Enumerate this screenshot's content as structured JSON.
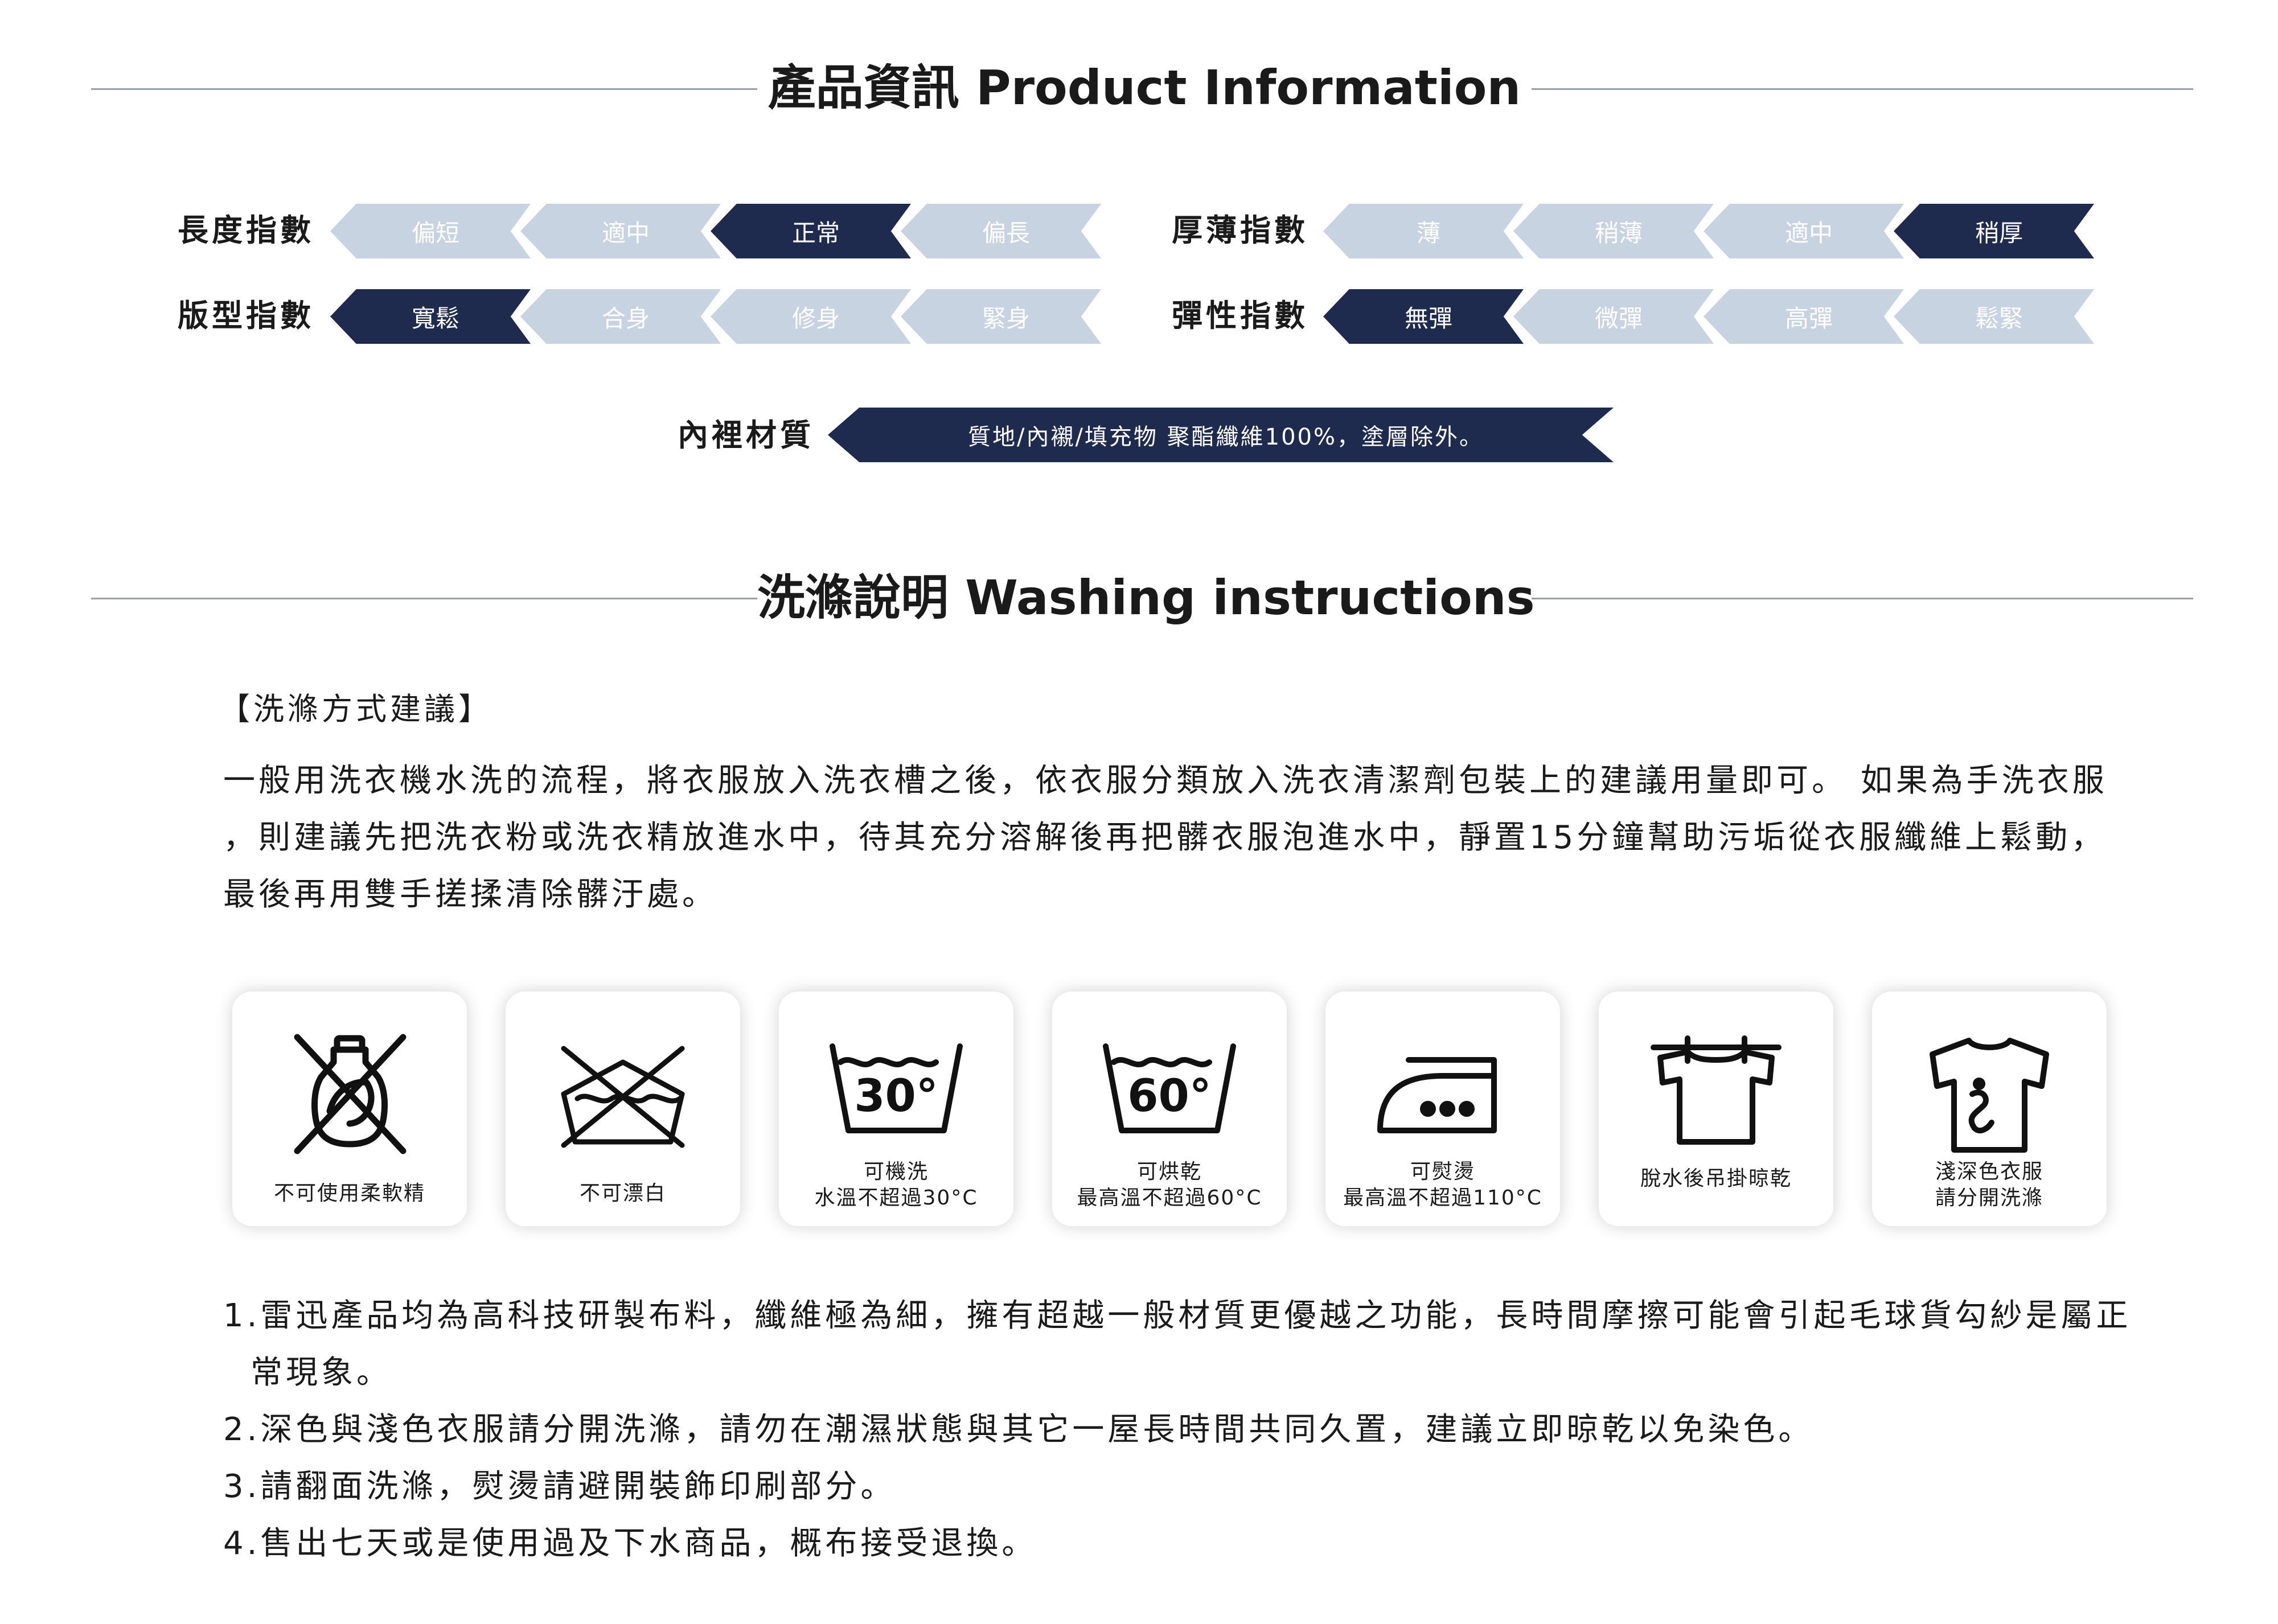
{
  "product_info": {
    "title": "產品資訊 Product Information",
    "length": {
      "label": "長度指數",
      "options": [
        "偏短",
        "適中",
        "正常",
        "偏長"
      ],
      "selected": 2
    },
    "thickness": {
      "label": "厚薄指數",
      "options": [
        "薄",
        "稍薄",
        "適中",
        "稍厚"
      ],
      "selected": 3
    },
    "fit": {
      "label": "版型指數",
      "options": [
        "寬鬆",
        "合身",
        "修身",
        "緊身"
      ],
      "selected": 0
    },
    "elasticity": {
      "label": "彈性指數",
      "options": [
        "無彈",
        "微彈",
        "高彈",
        "鬆緊"
      ],
      "selected": 0
    },
    "lining": {
      "label": "內裡材質",
      "value": "質地/內襯/填充物 聚酯纖維100%，塗層除外。"
    }
  },
  "washing": {
    "title": "洗滌說明 Washing instructions",
    "subheading": "【洗滌方式建議】",
    "paragraph_lines": [
      "一般用洗衣機水洗的流程，將衣服放入洗衣槽之後，依衣服分類放入洗衣清潔劑包裝上的建議用量即可。 如果為手洗衣服",
      "，則建議先把洗衣粉或洗衣精放進水中，待其充分溶解後再把髒衣服泡進水中，靜置15分鐘幫助污垢從衣服纖維上鬆動，",
      "最後再用雙手搓揉清除髒汙處。"
    ],
    "care_items": [
      {
        "icon": "no-fabric-softener-icon",
        "label": "不可使用柔軟精"
      },
      {
        "icon": "no-bleach-icon",
        "label": "不可漂白"
      },
      {
        "icon": "machine-wash-30-icon",
        "label": "可機洗\n水溫不超過30°C",
        "temp": "30°"
      },
      {
        "icon": "tumble-dry-60-icon",
        "label": "可烘乾\n最高溫不超過60°C",
        "temp": "60°"
      },
      {
        "icon": "iron-icon",
        "label": "可熨燙\n最高溫不超過110°C"
      },
      {
        "icon": "line-dry-icon",
        "label": "脫水後吊掛晾乾"
      },
      {
        "icon": "wash-separately-icon",
        "label": "淺深色衣服\n請分開洗滌"
      }
    ],
    "notes": [
      "1.雷迅產品均為高科技研製布料，纖維極為細，擁有超越一般材質更優越之功能，長時間摩擦可能會引起毛球貨勾紗是屬正",
      "常現象。",
      "2.深色與淺色衣服請分開洗滌，請勿在潮濕狀態與其它一屋長時間共同久置，建議立即晾乾以免染色。",
      "3.請翻面洗滌，熨燙請避開裝飾印刷部分。",
      "4.售出七天或是使用過及下水商品，概布接受退換。"
    ]
  },
  "colors": {
    "active": "#1e2b4e",
    "inactive": "#c8d3e1",
    "rule": "#9aa0a8"
  }
}
